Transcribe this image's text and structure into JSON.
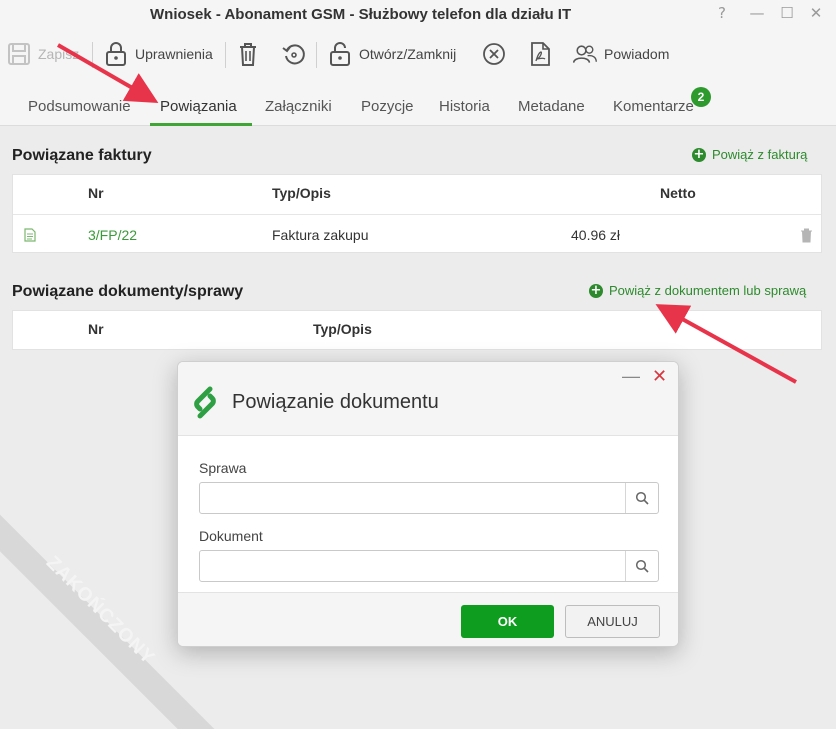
{
  "window": {
    "title": "Wniosek - Abonament GSM - Służbowy telefon dla działu IT",
    "help": "?",
    "minimize": "—",
    "maximize": "☐",
    "close": "✕"
  },
  "toolbar": {
    "save_label": "Zapisz",
    "permissions_label": "Uprawnienia",
    "open_close_label": "Otwórz/Zamknij",
    "notify_label": "Powiadom"
  },
  "tabs": [
    {
      "label": "Podsumowanie"
    },
    {
      "label": "Powiązania"
    },
    {
      "label": "Załączniki"
    },
    {
      "label": "Pozycje"
    },
    {
      "label": "Historia"
    },
    {
      "label": "Metadane"
    },
    {
      "label": "Komentarze"
    }
  ],
  "comments_count": "2",
  "invoices": {
    "title": "Powiązane faktury",
    "add_link": "Powiąż z fakturą",
    "headers": {
      "nr": "Nr",
      "type": "Typ/Opis",
      "net": "Netto"
    },
    "rows": [
      {
        "nr": "3/FP/22",
        "type": "Faktura zakupu",
        "net": "40.96 zł"
      }
    ]
  },
  "documents": {
    "title": "Powiązane dokumenty/sprawy",
    "add_link": "Powiąż z dokumentem lub sprawą",
    "headers": {
      "nr": "Nr",
      "type": "Typ/Opis"
    }
  },
  "watermark": "ZAKOŃCZONY",
  "dialog": {
    "title": "Powiązanie dokumentu",
    "case_label": "Sprawa",
    "case_value": "",
    "document_label": "Dokument",
    "document_value": "",
    "ok_label": "OK",
    "cancel_label": "ANULUJ"
  },
  "colors": {
    "accent": "#3fa535",
    "ok_button": "#0f9d1f",
    "annotation_arrow": "#e8344a"
  }
}
